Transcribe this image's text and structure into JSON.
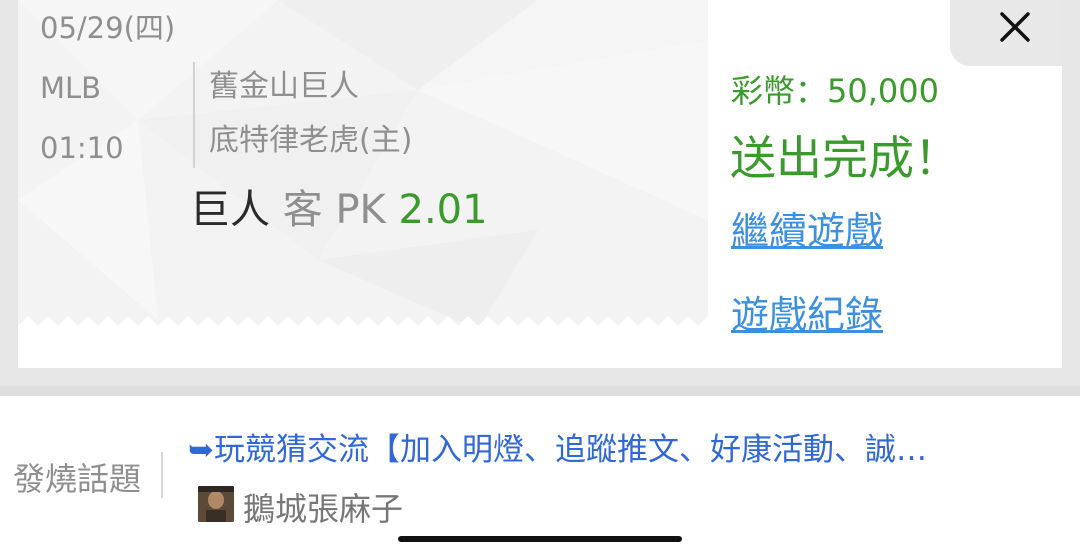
{
  "game": {
    "date": "05/29(四)",
    "league": "MLB",
    "time": "01:10",
    "away_team": "舊金山巨人",
    "home_team": "底特律老虎(主)"
  },
  "pick": {
    "team": "巨人",
    "side": "客",
    "type": "PK",
    "odds": "2.01"
  },
  "result": {
    "coins": "彩幣：50,000",
    "message": "送出完成！",
    "continue_link": "繼續遊戲",
    "history_link": "遊戲紀錄"
  },
  "hot_topic": {
    "label": "發燒話題",
    "title": "➥玩競猜交流【加入明燈、追蹤推文、好康活動、誠…",
    "author": "鵝城張麻子"
  },
  "icons": {
    "close": "close-icon",
    "avatar": "author-avatar"
  },
  "colors": {
    "green": "#3a9a2c",
    "link_blue": "#3d8fe0",
    "topic_blue": "#3167d6"
  }
}
